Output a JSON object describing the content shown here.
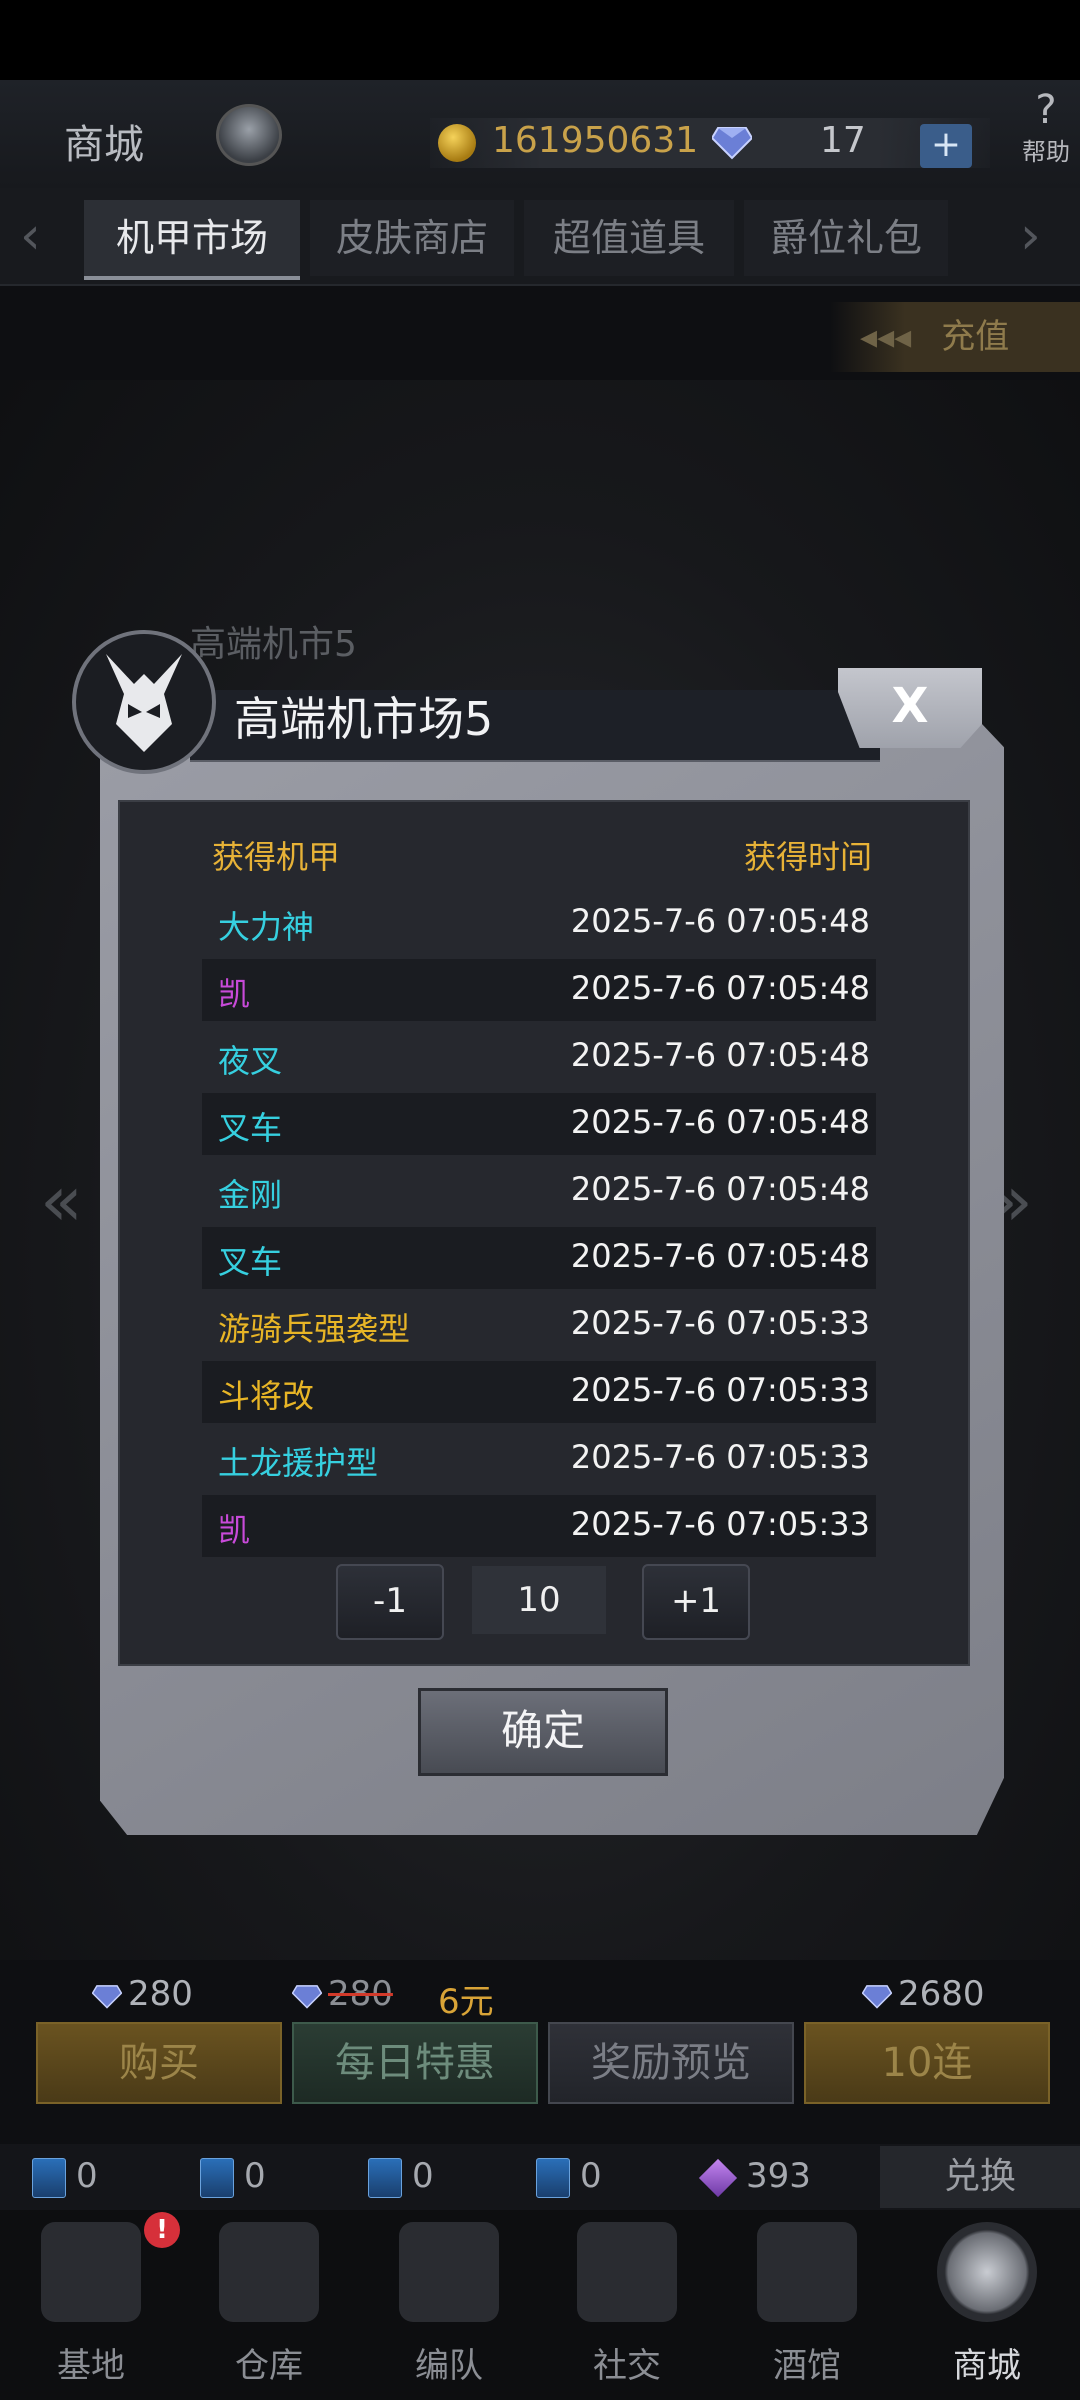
{
  "header": {
    "title": "商城",
    "coins": "161950631",
    "gems": "17",
    "add_label": "+",
    "help_icon": "?",
    "help_label": "帮助"
  },
  "tabs": [
    {
      "label": "机甲市场",
      "active": true
    },
    {
      "label": "皮肤商店",
      "active": false
    },
    {
      "label": "超值道具",
      "active": false
    },
    {
      "label": "爵位礼包",
      "active": false
    }
  ],
  "recharge_label": "充值",
  "background_banner": "高端机市5",
  "modal": {
    "title": "高端机市场5",
    "close_label": "X",
    "col_mech": "获得机甲",
    "col_time": "获得时间",
    "rows": [
      {
        "name": "大力神",
        "time": "2025-7-6 07:05:48",
        "color": "#36d0e0"
      },
      {
        "name": "凯",
        "time": "2025-7-6 07:05:48",
        "color": "#c84ad9"
      },
      {
        "name": "夜叉",
        "time": "2025-7-6 07:05:48",
        "color": "#36d0e0"
      },
      {
        "name": "叉车",
        "time": "2025-7-6 07:05:48",
        "color": "#36d0e0"
      },
      {
        "name": "金刚",
        "time": "2025-7-6 07:05:48",
        "color": "#36d0e0"
      },
      {
        "name": "叉车",
        "time": "2025-7-6 07:05:48",
        "color": "#36d0e0"
      },
      {
        "name": "游骑兵强袭型",
        "time": "2025-7-6 07:05:33",
        "color": "#e8b526"
      },
      {
        "name": "斗将改",
        "time": "2025-7-6 07:05:33",
        "color": "#e8b526"
      },
      {
        "name": "土龙援护型",
        "time": "2025-7-6 07:05:33",
        "color": "#36d0e0"
      },
      {
        "name": "凯",
        "time": "2025-7-6 07:05:33",
        "color": "#c84ad9"
      }
    ],
    "minus_label": "-1",
    "quantity": "10",
    "plus_label": "+1",
    "confirm_label": "确定"
  },
  "purchase": {
    "price_single": "280",
    "price_original": "280",
    "price_discount": "6元",
    "price_ten": "2680",
    "buy_label": "购买",
    "daily_label": "每日特惠",
    "preview_label": "奖励预览",
    "ten_label": "10连"
  },
  "currencies": {
    "card1": "0",
    "card2": "0",
    "card3": "0",
    "card4": "0",
    "crystal": "393",
    "exchange_label": "兑换"
  },
  "nav": [
    {
      "label": "基地"
    },
    {
      "label": "仓库"
    },
    {
      "label": "编队"
    },
    {
      "label": "社交"
    },
    {
      "label": "酒馆"
    },
    {
      "label": "商城"
    }
  ],
  "badge": "!"
}
